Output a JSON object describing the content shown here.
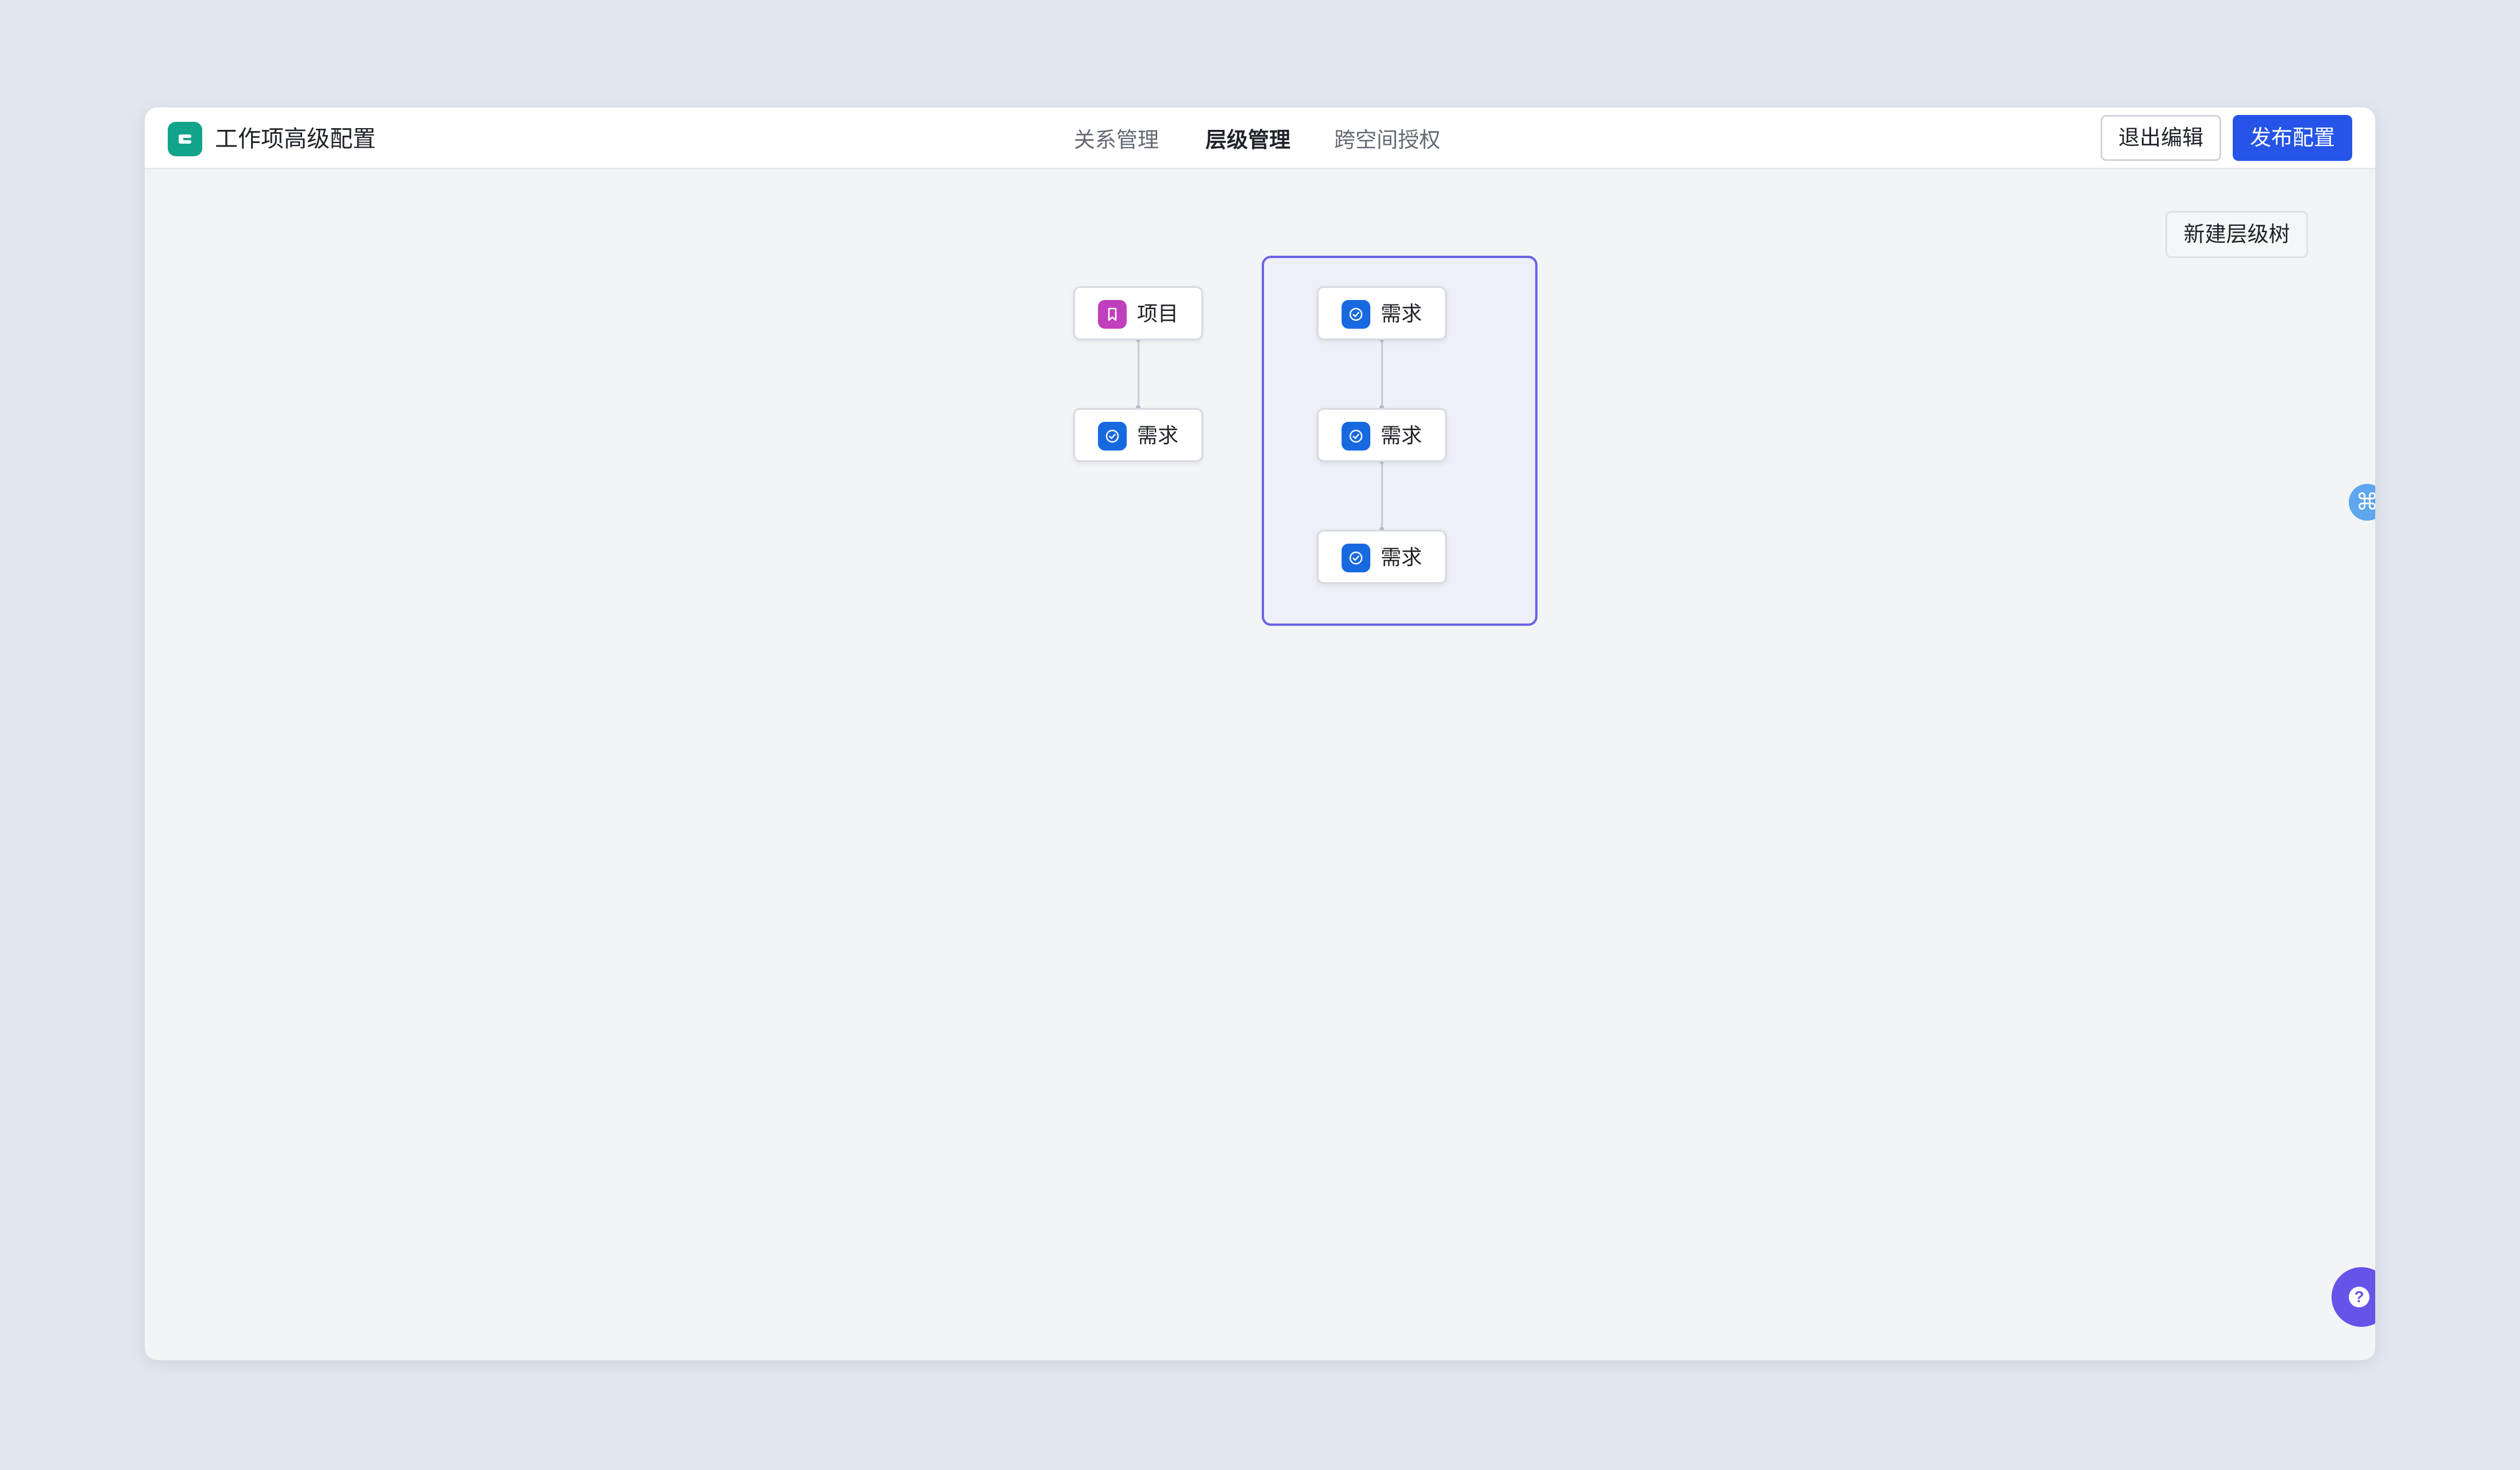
{
  "app": {
    "title": "工作项高级配置",
    "icon": "app-logo-icon",
    "accent_color": "#12a48a"
  },
  "tabs": [
    {
      "label": "关系管理",
      "active": false
    },
    {
      "label": "层级管理",
      "active": true
    },
    {
      "label": "跨空间授权",
      "active": false
    }
  ],
  "actions": {
    "exit_label": "退出编辑",
    "publish_label": "发布配置",
    "publish_color": "#2654e8"
  },
  "canvas": {
    "new_tree_label": "新建层级树",
    "trees": [
      {
        "selected": false,
        "nodes": [
          {
            "label": "项目",
            "icon": "bookmark-icon",
            "icon_color": "#c03fbd"
          },
          {
            "label": "需求",
            "icon": "check-circle-icon",
            "icon_color": "#1769e0"
          }
        ]
      },
      {
        "selected": true,
        "selection_color": "#6a63e6",
        "nodes": [
          {
            "label": "需求",
            "icon": "check-circle-icon",
            "icon_color": "#1769e0"
          },
          {
            "label": "需求",
            "icon": "check-circle-icon",
            "icon_color": "#1769e0"
          },
          {
            "label": "需求",
            "icon": "check-circle-icon",
            "icon_color": "#1769e0"
          }
        ]
      }
    ]
  },
  "floating": {
    "shortcut_glyph": "⌘",
    "help_glyph": "?"
  }
}
